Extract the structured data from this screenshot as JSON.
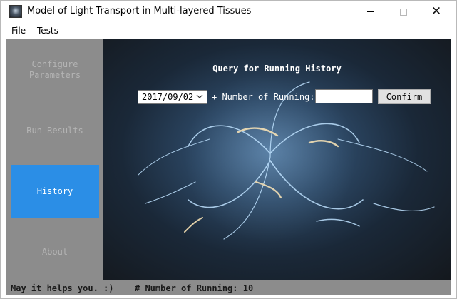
{
  "window": {
    "title": "Model of Light Transport in Multi-layered Tissues",
    "icon": "app-icon",
    "controls": [
      "minimize-icon",
      "maximize-icon",
      "close-icon"
    ]
  },
  "menu": {
    "file_label": "File",
    "tests_label": "Tests"
  },
  "sidebar": {
    "items": [
      {
        "label": "Configure\nParameters",
        "active": false
      },
      {
        "label": "Run Results",
        "active": false
      },
      {
        "label": "History",
        "active": true
      },
      {
        "label": "About",
        "active": false
      }
    ],
    "active_color": "#2b8ee6"
  },
  "history": {
    "title": "Query for Running History",
    "date_value": "2017/09/02",
    "running_label": "+ Number of Running:",
    "running_value": "",
    "confirm_label": "Confirm"
  },
  "status": {
    "left_text": "May it helps you. :)",
    "right_text": "# Number of Running: 10"
  }
}
